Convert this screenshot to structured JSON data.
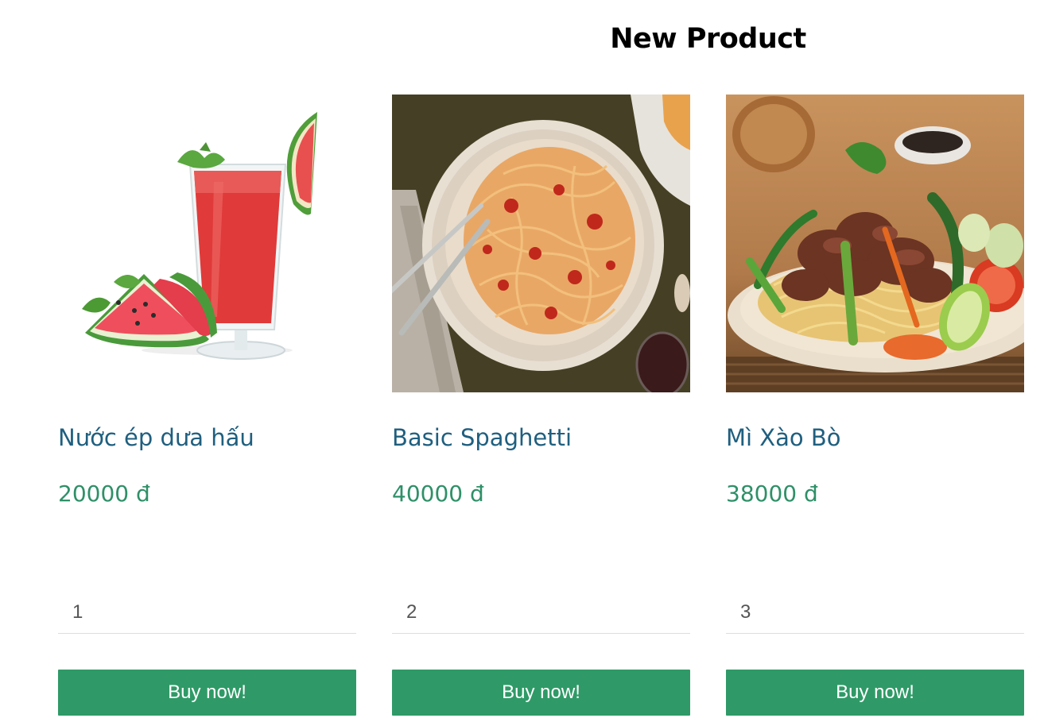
{
  "section": {
    "title": "New Product"
  },
  "products": [
    {
      "name": "Nước ép dưa hấu",
      "price": "20000 đ",
      "quantity": "1",
      "buy_label": "Buy now!",
      "image": "watermelon-juice-photo"
    },
    {
      "name": "Basic Spaghetti",
      "price": "40000 đ",
      "quantity": "2",
      "buy_label": "Buy now!",
      "image": "spaghetti-plate-photo"
    },
    {
      "name": "Mì Xào Bò",
      "price": "38000 đ",
      "quantity": "3",
      "buy_label": "Buy now!",
      "image": "stir-fried-beef-noodles-photo"
    }
  ],
  "colors": {
    "product_name": "#1f5f7f",
    "price": "#2f9068",
    "button": "#2f9a67",
    "button_text": "#ffffff"
  }
}
